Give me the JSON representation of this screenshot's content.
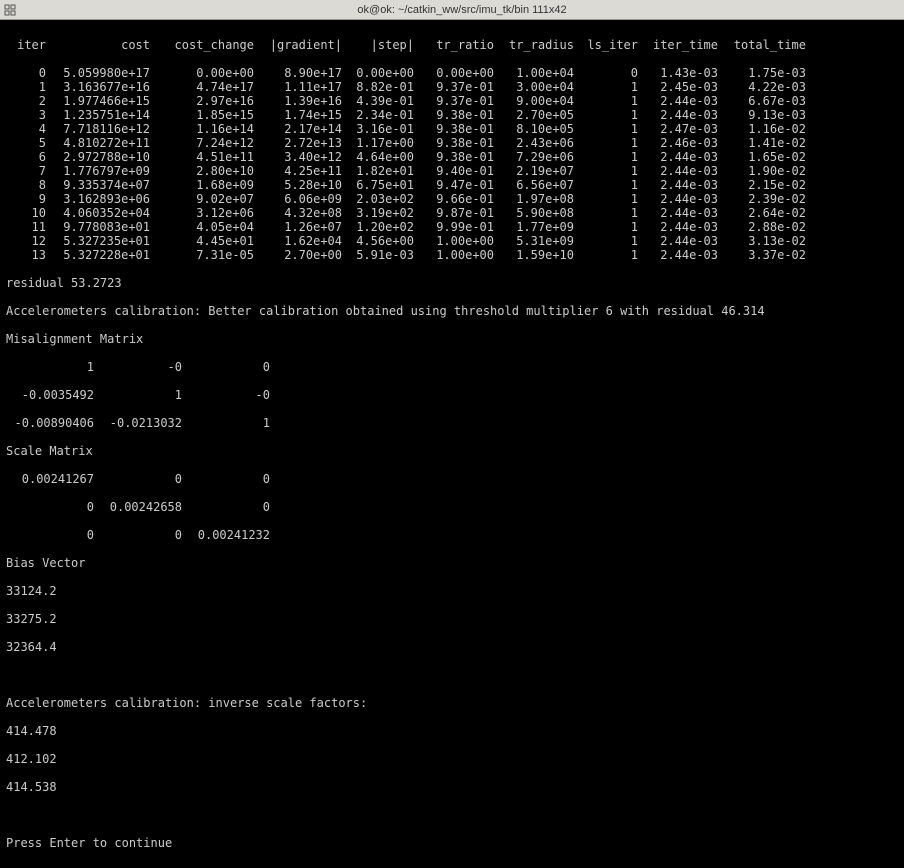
{
  "window": {
    "title": "ok@ok: ~/catkin_ww/src/imu_tk/bin 111x42"
  },
  "headers": {
    "iter": "iter",
    "cost": "cost",
    "cost_change": "cost_change",
    "gradient": "|gradient|",
    "step": "|step|",
    "tr_ratio": "tr_ratio",
    "tr_radius": "tr_radius",
    "ls_iter": "ls_iter",
    "iter_time": "iter_time",
    "total_time": "total_time"
  },
  "rows": [
    {
      "iter": "0",
      "cost": "5.059980e+17",
      "change": "0.00e+00",
      "grad": "8.90e+17",
      "step": "0.00e+00",
      "tr": "0.00e+00",
      "rad": "1.00e+04",
      "ls": "0",
      "itime": "1.43e-03",
      "ttime": "1.75e-03"
    },
    {
      "iter": "1",
      "cost": "3.163677e+16",
      "change": "4.74e+17",
      "grad": "1.11e+17",
      "step": "8.82e-01",
      "tr": "9.37e-01",
      "rad": "3.00e+04",
      "ls": "1",
      "itime": "2.45e-03",
      "ttime": "4.22e-03"
    },
    {
      "iter": "2",
      "cost": "1.977466e+15",
      "change": "2.97e+16",
      "grad": "1.39e+16",
      "step": "4.39e-01",
      "tr": "9.37e-01",
      "rad": "9.00e+04",
      "ls": "1",
      "itime": "2.44e-03",
      "ttime": "6.67e-03"
    },
    {
      "iter": "3",
      "cost": "1.235751e+14",
      "change": "1.85e+15",
      "grad": "1.74e+15",
      "step": "2.34e-01",
      "tr": "9.38e-01",
      "rad": "2.70e+05",
      "ls": "1",
      "itime": "2.44e-03",
      "ttime": "9.13e-03"
    },
    {
      "iter": "4",
      "cost": "7.718116e+12",
      "change": "1.16e+14",
      "grad": "2.17e+14",
      "step": "3.16e-01",
      "tr": "9.38e-01",
      "rad": "8.10e+05",
      "ls": "1",
      "itime": "2.47e-03",
      "ttime": "1.16e-02"
    },
    {
      "iter": "5",
      "cost": "4.810272e+11",
      "change": "7.24e+12",
      "grad": "2.72e+13",
      "step": "1.17e+00",
      "tr": "9.38e-01",
      "rad": "2.43e+06",
      "ls": "1",
      "itime": "2.46e-03",
      "ttime": "1.41e-02"
    },
    {
      "iter": "6",
      "cost": "2.972788e+10",
      "change": "4.51e+11",
      "grad": "3.40e+12",
      "step": "4.64e+00",
      "tr": "9.38e-01",
      "rad": "7.29e+06",
      "ls": "1",
      "itime": "2.44e-03",
      "ttime": "1.65e-02"
    },
    {
      "iter": "7",
      "cost": "1.776797e+09",
      "change": "2.80e+10",
      "grad": "4.25e+11",
      "step": "1.82e+01",
      "tr": "9.40e-01",
      "rad": "2.19e+07",
      "ls": "1",
      "itime": "2.44e-03",
      "ttime": "1.90e-02"
    },
    {
      "iter": "8",
      "cost": "9.335374e+07",
      "change": "1.68e+09",
      "grad": "5.28e+10",
      "step": "6.75e+01",
      "tr": "9.47e-01",
      "rad": "6.56e+07",
      "ls": "1",
      "itime": "2.44e-03",
      "ttime": "2.15e-02"
    },
    {
      "iter": "9",
      "cost": "3.162893e+06",
      "change": "9.02e+07",
      "grad": "6.06e+09",
      "step": "2.03e+02",
      "tr": "9.66e-01",
      "rad": "1.97e+08",
      "ls": "1",
      "itime": "2.44e-03",
      "ttime": "2.39e-02"
    },
    {
      "iter": "10",
      "cost": "4.060352e+04",
      "change": "3.12e+06",
      "grad": "4.32e+08",
      "step": "3.19e+02",
      "tr": "9.87e-01",
      "rad": "5.90e+08",
      "ls": "1",
      "itime": "2.44e-03",
      "ttime": "2.64e-02"
    },
    {
      "iter": "11",
      "cost": "9.778083e+01",
      "change": "4.05e+04",
      "grad": "1.26e+07",
      "step": "1.20e+02",
      "tr": "9.99e-01",
      "rad": "1.77e+09",
      "ls": "1",
      "itime": "2.44e-03",
      "ttime": "2.88e-02"
    },
    {
      "iter": "12",
      "cost": "5.327235e+01",
      "change": "4.45e+01",
      "grad": "1.62e+04",
      "step": "4.56e+00",
      "tr": "1.00e+00",
      "rad": "5.31e+09",
      "ls": "1",
      "itime": "2.44e-03",
      "ttime": "3.13e-02"
    },
    {
      "iter": "13",
      "cost": "5.327228e+01",
      "change": "7.31e-05",
      "grad": "2.70e+00",
      "step": "5.91e-03",
      "tr": "1.00e+00",
      "rad": "1.59e+10",
      "ls": "1",
      "itime": "2.44e-03",
      "ttime": "3.37e-02"
    }
  ],
  "residual_line": "residual 53.2723",
  "calib_line": "Accelerometers calibration: Better calibration obtained using threshold multiplier 6 with residual 46.314",
  "misalign_title": "Misalignment Matrix",
  "misalign": {
    "r0": {
      "a": "1",
      "b": "-0",
      "c": "0"
    },
    "r1": {
      "a": "-0.0035492",
      "b": "1",
      "c": "-0"
    },
    "r2": {
      "a": "-0.00890406",
      "b": "-0.0213032",
      "c": "1"
    }
  },
  "scale_title": "Scale Matrix",
  "scale": {
    "r0": {
      "a": "0.00241267",
      "b": "0",
      "c": "0"
    },
    "r1": {
      "a": "0",
      "b": "0.00242658",
      "c": "0"
    },
    "r2": {
      "a": "0",
      "b": "0",
      "c": "0.00241232"
    }
  },
  "bias_title": "Bias Vector",
  "bias": {
    "a": "33124.2",
    "b": "33275.2",
    "c": "32364.4"
  },
  "inverse_title": "Accelerometers calibration: inverse scale factors:",
  "inverse": {
    "a": "414.478",
    "b": "412.102",
    "c": "414.538"
  },
  "prompt": "Press Enter to continue"
}
